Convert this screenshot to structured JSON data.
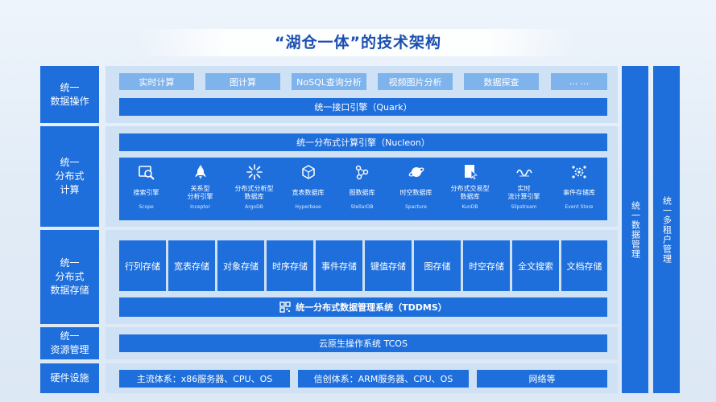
{
  "title": "“湖仓一体”的技术架构",
  "layers": {
    "data_ops": "统一\n数据操作",
    "distributed_compute": "统一\n分布式\n计算",
    "data_storage": "统一\n分布式\n数据存储",
    "resource_mgmt": "统一\n资源管理",
    "hardware": "硬件设施"
  },
  "data_ops": {
    "tags": [
      "实时计算",
      "图计算",
      "NoSQL查询分析",
      "视频图片分析",
      "数据探查",
      "... ..."
    ],
    "interface_bar": "统一接口引擎（Quark）"
  },
  "compute": {
    "engine_bar": "统一分布式计算引擎（Nucleon）",
    "engines": [
      {
        "name": "搜索引擎",
        "en": "Scope",
        "icon": "search-engine-icon"
      },
      {
        "name": "关系型\n分析引擎",
        "en": "Inceptor",
        "icon": "rocket-icon"
      },
      {
        "name": "分布式分析型\n数据库",
        "en": "ArgoDB",
        "icon": "burst-icon"
      },
      {
        "name": "宽表数据库",
        "en": "Hyperbase",
        "icon": "cube-network-icon"
      },
      {
        "name": "图数据库",
        "en": "StellarDB",
        "icon": "graph-nodes-icon"
      },
      {
        "name": "时空数据库",
        "en": "Spacture",
        "icon": "planet-icon"
      },
      {
        "name": "分布式交易型\n数据库",
        "en": "KunDB",
        "icon": "document-cursor-icon"
      },
      {
        "name": "实时\n流计算引擎",
        "en": "Slipstream",
        "icon": "wave-icon"
      },
      {
        "name": "事件存储库",
        "en": "Event Store",
        "icon": "gear-network-icon"
      }
    ]
  },
  "storage": {
    "cells": [
      "行列存储",
      "宽表存储",
      "对象存储",
      "时序存储",
      "事件存储",
      "键值存储",
      "图存储",
      "时空存储",
      "全文搜索",
      "文档存储"
    ],
    "system_bar": "统一分布式数据管理系统（TDDMS）"
  },
  "resource": {
    "bar": "云原生操作系统  TCOS"
  },
  "hardware": {
    "items": [
      "主流体系：x86服务器、CPU、OS",
      "信创体系：ARM服务器、CPU、OS",
      "网络等"
    ]
  },
  "side": {
    "data_mgmt": "统一数据管理",
    "tenant_mgmt": "统一多租户管理"
  }
}
